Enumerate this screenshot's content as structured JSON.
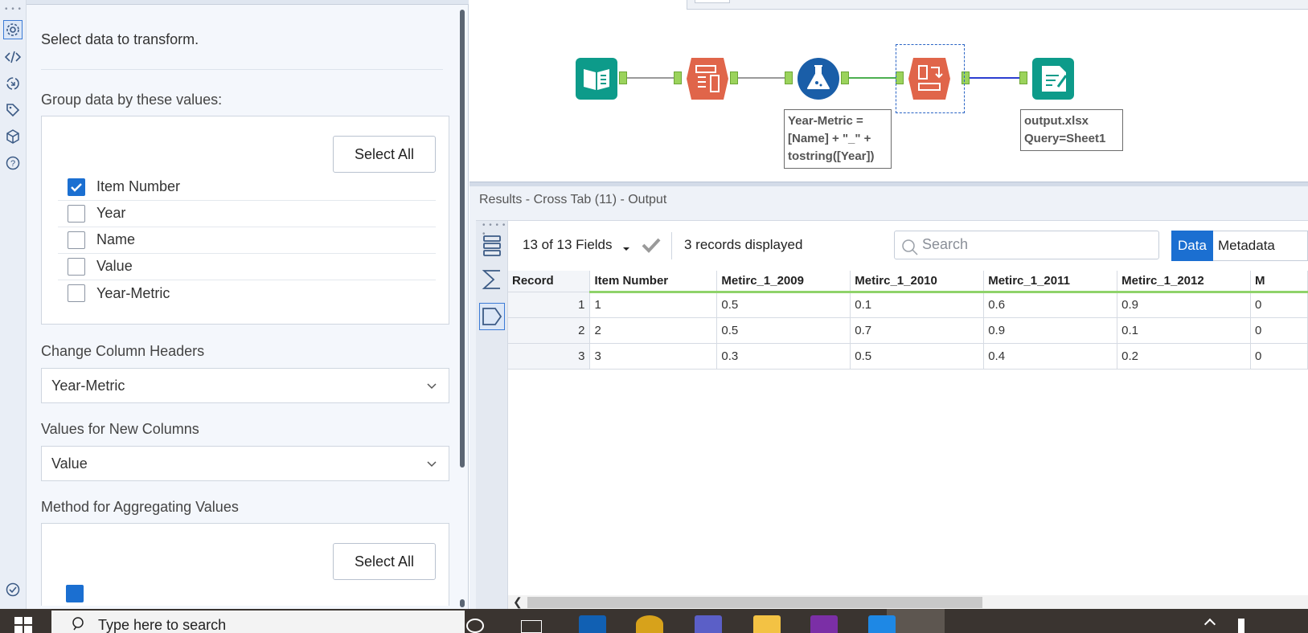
{
  "config_panel": {
    "intro": "Select data to transform.",
    "group_label": "Group data by these values:",
    "select_all_label": "Select All",
    "group_fields": [
      {
        "label": "Item Number",
        "checked": true
      },
      {
        "label": "Year",
        "checked": false
      },
      {
        "label": "Name",
        "checked": false
      },
      {
        "label": "Value",
        "checked": false
      },
      {
        "label": "Year-Metric",
        "checked": false
      }
    ],
    "change_headers_label": "Change Column Headers",
    "change_headers_value": "Year-Metric",
    "values_label": "Values for New Columns",
    "values_value": "Value",
    "method_label": "Method for Aggregating Values",
    "method_select_all_label": "Select All"
  },
  "canvas": {
    "formula_annotation": "Year-Metric =\n[Name] + \"_\" +\ntostring([Year])",
    "output_annotation": "output.xlsx\nQuery=Sheet1",
    "tools": [
      "input-tool-icon",
      "transpose-tool-icon",
      "formula-tool-icon",
      "crosstab-tool-icon",
      "output-tool-icon"
    ]
  },
  "results": {
    "title": "Results - Cross Tab (11) - Output",
    "fields_label": "13 of 13 Fields",
    "records_label": "3 records displayed",
    "search_placeholder": "Search",
    "tab_data": "Data",
    "tab_metadata": "Metadata",
    "columns": [
      "Record",
      "Item Number",
      "Metirc_1_2009",
      "Metirc_1_2010",
      "Metirc_1_2011",
      "Metirc_1_2012",
      "M"
    ],
    "rows": [
      [
        "1",
        "1",
        "0.5",
        "0.1",
        "0.6",
        "0.9",
        "0"
      ],
      [
        "2",
        "2",
        "0.5",
        "0.7",
        "0.9",
        "0.1",
        "0"
      ],
      [
        "3",
        "3",
        "0.3",
        "0.5",
        "0.4",
        "0.2",
        "0"
      ]
    ]
  },
  "taskbar": {
    "search_placeholder": "Type here to search"
  },
  "colors": {
    "accent": "#1b6fd1",
    "input_tool": "#0d9b8a",
    "transform_tool": "#e0654a",
    "formula_tool": "#1a5ea8",
    "output_tool": "#0d9b8a",
    "connection_green": "#4caf50",
    "connection_blue": "#2b3ed1"
  }
}
